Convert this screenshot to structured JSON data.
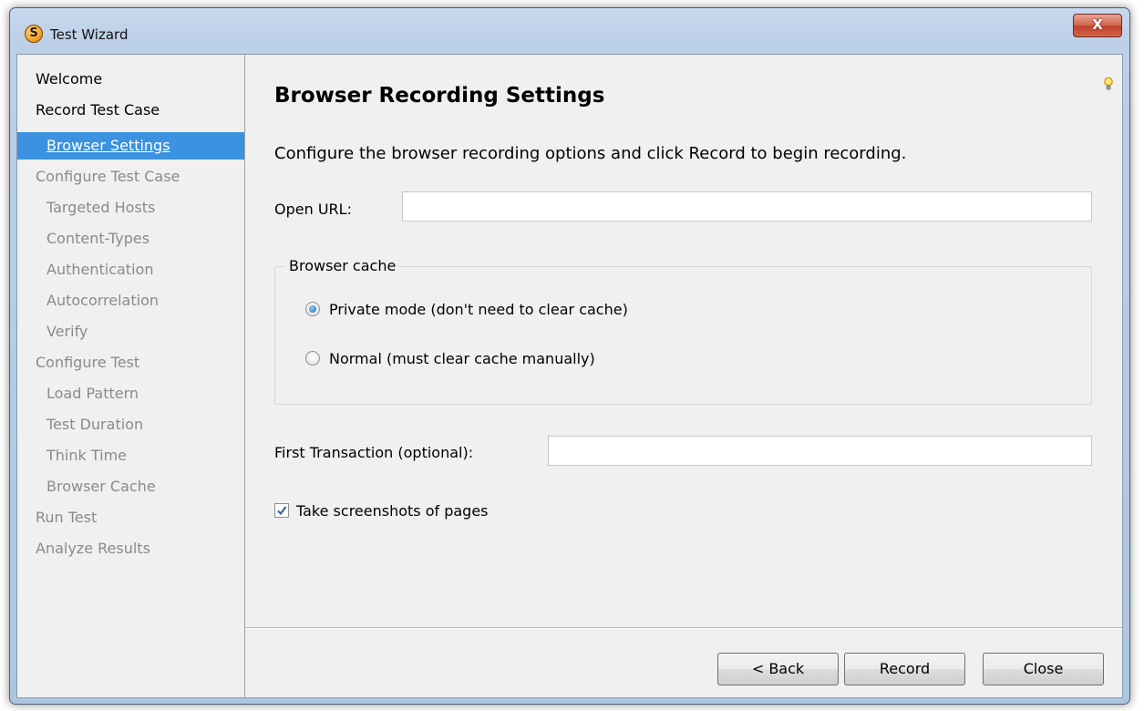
{
  "window": {
    "title": "Test Wizard",
    "app_icon_glyph": "S",
    "close_glyph": "X"
  },
  "sidebar": {
    "items": [
      {
        "label": "Welcome",
        "state": "done"
      },
      {
        "label": "Record Test Case",
        "state": "done"
      },
      {
        "label": "Browser Settings",
        "state": "current"
      },
      {
        "label": "Configure Test Case",
        "state": "pending"
      },
      {
        "label": "Targeted Hosts",
        "state": "pending"
      },
      {
        "label": "Content-Types",
        "state": "pending"
      },
      {
        "label": "Authentication",
        "state": "pending"
      },
      {
        "label": "Autocorrelation",
        "state": "pending"
      },
      {
        "label": "Verify",
        "state": "pending"
      },
      {
        "label": "Configure Test",
        "state": "pending"
      },
      {
        "label": "Load Pattern",
        "state": "pending"
      },
      {
        "label": "Test Duration",
        "state": "pending"
      },
      {
        "label": "Think Time",
        "state": "pending"
      },
      {
        "label": "Browser Cache",
        "state": "pending"
      },
      {
        "label": "Run Test",
        "state": "pending"
      },
      {
        "label": "Analyze Results",
        "state": "pending"
      }
    ]
  },
  "main": {
    "heading": "Browser Recording Settings",
    "intro": "Configure the browser recording options and click Record to begin recording.",
    "open_url_label": "Open URL:",
    "open_url_value": "",
    "browser_cache": {
      "legend": "Browser cache",
      "options": [
        {
          "label": "Private mode (don't need to clear cache)",
          "selected": true
        },
        {
          "label": "Normal (must clear cache manually)",
          "selected": false
        }
      ]
    },
    "first_transaction_label": "First Transaction (optional):",
    "first_transaction_value": "",
    "screenshots_label": "Take screenshots of pages",
    "screenshots_checked": true
  },
  "buttons": {
    "back": "< Back",
    "record": "Record",
    "close": "Close"
  },
  "icons": {
    "tip": "lightbulb-icon",
    "app": "app-logo-icon",
    "close": "close-icon"
  },
  "colors": {
    "selection": "#3b92e0",
    "pending_text": "#8a8a8a",
    "close_button": "#c2412a"
  }
}
